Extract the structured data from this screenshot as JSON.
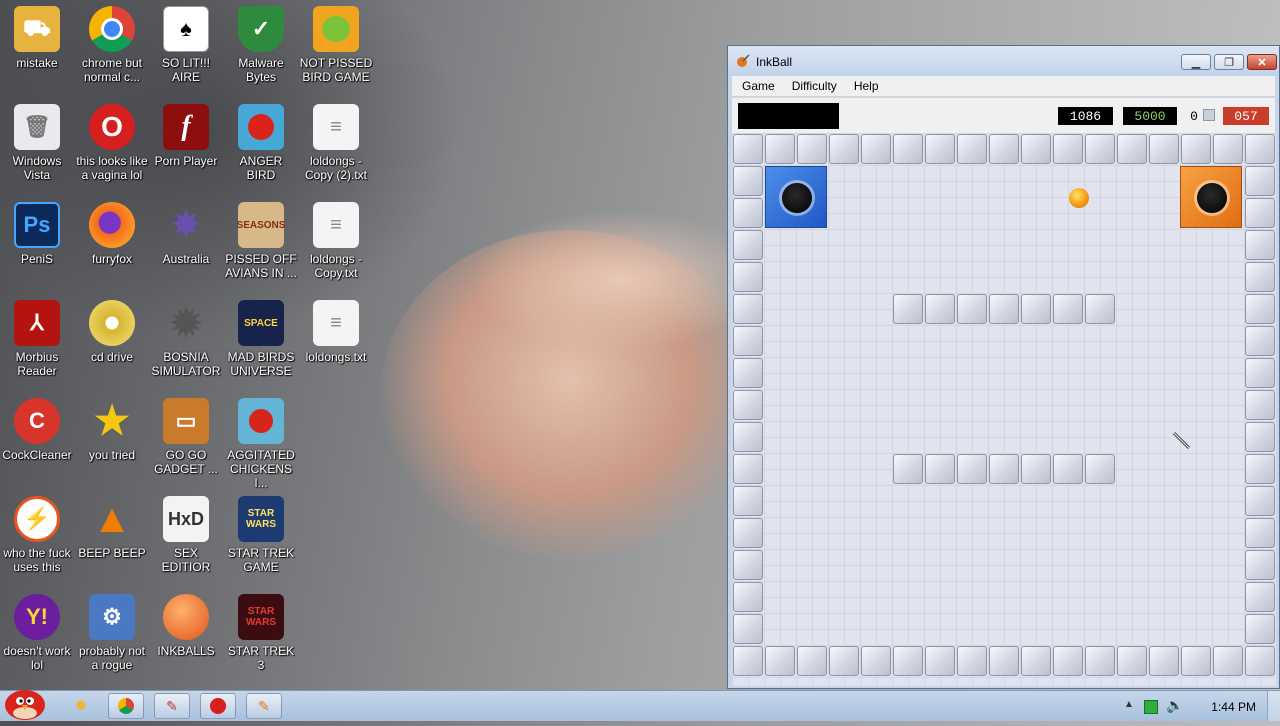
{
  "desktop": {
    "icons": [
      {
        "label": "mistake",
        "icon": "folder-user-icon"
      },
      {
        "label": "chrome but normal c...",
        "icon": "chrome-icon"
      },
      {
        "label": "SO LIT!!! AIRE",
        "icon": "solitaire-cards-icon"
      },
      {
        "label": "Malware Bytes",
        "icon": "shield-check-icon"
      },
      {
        "label": "NOT PISSED BIRD GAME",
        "icon": "green-pig-icon"
      },
      {
        "label": "Windows Vista",
        "icon": "bin-icon"
      },
      {
        "label": "this looks like a vagina lol",
        "icon": "opera-icon"
      },
      {
        "label": "Porn Player",
        "icon": "flash-icon"
      },
      {
        "label": "ANGER BIRD",
        "icon": "angry-bird-icon"
      },
      {
        "label": "loldongs - Copy (2).txt",
        "icon": "text-file-icon"
      },
      {
        "label": "PeniS",
        "icon": "photoshop-icon"
      },
      {
        "label": "furryfox",
        "icon": "firefox-icon"
      },
      {
        "label": "Australia",
        "icon": "spider-solitaire-icon"
      },
      {
        "label": "PISSED OFF AVIANS IN ...",
        "icon": "angry-birds-seasons-icon"
      },
      {
        "label": "loldongs - Copy.txt",
        "icon": "text-file-icon"
      },
      {
        "label": "Morbius Reader",
        "icon": "acrobat-icon"
      },
      {
        "label": "cd drive",
        "icon": "cd-drive-icon"
      },
      {
        "label": "BOSNIA SIMULATOR",
        "icon": "minesweeper-icon"
      },
      {
        "label": "MAD BIRDS UNIVERSE",
        "icon": "angry-birds-space-icon"
      },
      {
        "label": "loldongs.txt",
        "icon": "text-file-icon"
      },
      {
        "label": "CockCleaner",
        "icon": "ccleaner-icon"
      },
      {
        "label": "you tried",
        "icon": "star-icon"
      },
      {
        "label": "GO GO GADGET ...",
        "icon": "briefcase-icon"
      },
      {
        "label": "AGGITATED CHICKENS I...",
        "icon": "angry-birds-rio-icon"
      },
      {
        "label": "who the fuck uses this",
        "icon": "winamp-icon"
      },
      {
        "label": "BEEP BEEP",
        "icon": "vlc-icon"
      },
      {
        "label": "SEX EDITIOR",
        "icon": "hxd-icon"
      },
      {
        "label": "STAR TREK GAME",
        "icon": "angry-birds-star-wars-icon"
      },
      {
        "label": "doesn't work lol",
        "icon": "yahoo-messenger-icon"
      },
      {
        "label": "probably not a rogue",
        "icon": "computer-gear-icon"
      },
      {
        "label": "INKBALLS",
        "icon": "inkball-icon"
      },
      {
        "label": "STAR TREK 3",
        "icon": "angry-birds-star-wars-2-icon"
      }
    ]
  },
  "window": {
    "title": "InkBall",
    "menu": [
      "Game",
      "Difficulty",
      "Help"
    ],
    "scores": {
      "current": "1086",
      "max": "5000",
      "balls": "0",
      "timer": "057"
    }
  },
  "taskbar": {
    "clock": "1:44 PM",
    "items": [
      "angry-bird-start-icon",
      "explorer-icon",
      "chrome-icon",
      "inkball-task-icon",
      "opera-icon",
      "inkball-task-icon-2"
    ]
  },
  "colors": {
    "blue_hole": "#2e6fd6",
    "orange_hole": "#ec8420",
    "timer_bg": "#c93d2a",
    "max_score_text": "#8fcf69"
  }
}
